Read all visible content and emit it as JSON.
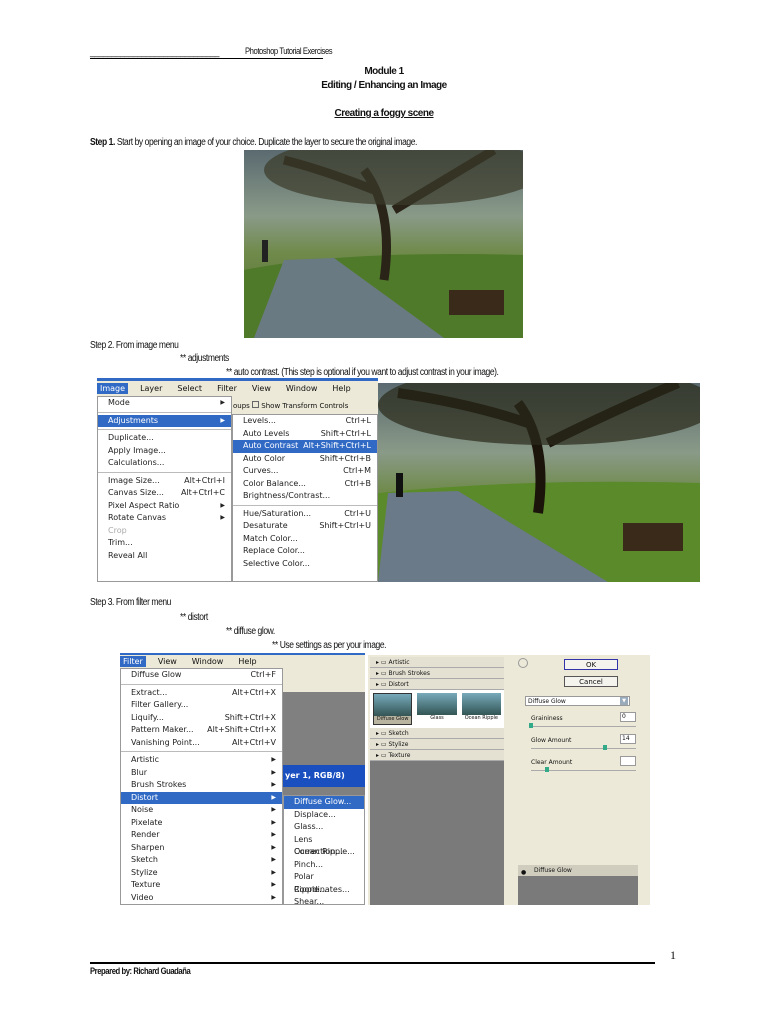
{
  "header": {
    "dashes": "______________________________",
    "title": "Photoshop Tutorial Exercises"
  },
  "module": "Module 1",
  "subtitle": "Editing / Enhancing an Image",
  "section_title": "Creating a foggy scene",
  "step1": {
    "label": "Step 1.",
    "text": "Start by opening an image of your choice. Duplicate the layer to secure the original image."
  },
  "step2": {
    "line1": "Step 2. From image menu",
    "line2": "** adjustments",
    "line3": "** auto contrast. (This step is optional if you want to adjust contrast in your image)."
  },
  "step3": {
    "line1": "Step 3. From filter menu",
    "line2": "** distort",
    "line3": "** diffuse glow.",
    "line4": "** Use settings as per your image."
  },
  "shot2": {
    "menubar": [
      "Image",
      "Layer",
      "Select",
      "Filter",
      "View",
      "Window",
      "Help"
    ],
    "toolbar_text": "oups",
    "toolbar_checkbox": "Show Transform Controls",
    "image_menu": [
      {
        "label": "Mode",
        "arrow": true
      },
      {
        "sep": true
      },
      {
        "label": "Adjustments",
        "arrow": true,
        "sel": true
      },
      {
        "sep": true
      },
      {
        "label": "Duplicate..."
      },
      {
        "label": "Apply Image..."
      },
      {
        "label": "Calculations..."
      },
      {
        "sep": true
      },
      {
        "label": "Image Size...",
        "sc": "Alt+Ctrl+I"
      },
      {
        "label": "Canvas Size...",
        "sc": "Alt+Ctrl+C"
      },
      {
        "label": "Pixel Aspect Ratio",
        "arrow": true
      },
      {
        "label": "Rotate Canvas",
        "arrow": true
      },
      {
        "label": "Crop",
        "dis": true
      },
      {
        "label": "Trim..."
      },
      {
        "label": "Reveal All"
      }
    ],
    "adjust_menu": [
      {
        "label": "Levels...",
        "sc": "Ctrl+L"
      },
      {
        "label": "Auto Levels",
        "sc": "Shift+Ctrl+L"
      },
      {
        "label": "Auto Contrast",
        "sc": "Alt+Shift+Ctrl+L",
        "sel": true
      },
      {
        "label": "Auto Color",
        "sc": "Shift+Ctrl+B"
      },
      {
        "label": "Curves...",
        "sc": "Ctrl+M"
      },
      {
        "label": "Color Balance...",
        "sc": "Ctrl+B"
      },
      {
        "label": "Brightness/Contrast..."
      },
      {
        "sep": true
      },
      {
        "label": "Hue/Saturation...",
        "sc": "Ctrl+U"
      },
      {
        "label": "Desaturate",
        "sc": "Shift+Ctrl+U"
      },
      {
        "label": "Match Color..."
      },
      {
        "label": "Replace Color..."
      },
      {
        "label": "Selective Color..."
      }
    ]
  },
  "shot3": {
    "menubar": [
      "Filter",
      "View",
      "Window",
      "Help"
    ],
    "doc_title": "yer 1, RGB/8)",
    "filter_menu": [
      {
        "label": "Diffuse Glow",
        "sc": "Ctrl+F"
      },
      {
        "sep": true
      },
      {
        "label": "Extract...",
        "sc": "Alt+Ctrl+X"
      },
      {
        "label": "Filter Gallery..."
      },
      {
        "label": "Liquify...",
        "sc": "Shift+Ctrl+X"
      },
      {
        "label": "Pattern Maker...",
        "sc": "Alt+Shift+Ctrl+X"
      },
      {
        "label": "Vanishing Point...",
        "sc": "Alt+Ctrl+V"
      },
      {
        "sep": true
      },
      {
        "label": "Artistic",
        "arrow": true
      },
      {
        "label": "Blur",
        "arrow": true
      },
      {
        "label": "Brush Strokes",
        "arrow": true
      },
      {
        "label": "Distort",
        "arrow": true,
        "sel": true
      },
      {
        "label": "Noise",
        "arrow": true
      },
      {
        "label": "Pixelate",
        "arrow": true
      },
      {
        "label": "Render",
        "arrow": true
      },
      {
        "label": "Sharpen",
        "arrow": true
      },
      {
        "label": "Sketch",
        "arrow": true
      },
      {
        "label": "Stylize",
        "arrow": true
      },
      {
        "label": "Texture",
        "arrow": true
      },
      {
        "label": "Video",
        "arrow": true
      }
    ],
    "distort_menu": [
      {
        "label": "Diffuse Glow...",
        "sel": true
      },
      {
        "label": "Displace..."
      },
      {
        "label": "Glass..."
      },
      {
        "label": "Lens Correction..."
      },
      {
        "label": "Ocean Ripple..."
      },
      {
        "label": "Pinch..."
      },
      {
        "label": "Polar Coordinates..."
      },
      {
        "label": "Ripple..."
      },
      {
        "label": "Shear..."
      }
    ],
    "gallery": {
      "folders_top": [
        "Artistic",
        "Brush Strokes",
        "Distort"
      ],
      "thumbs": [
        "Diffuse Glow",
        "Glass",
        "Ocean Ripple"
      ],
      "folders_bottom": [
        "Sketch",
        "Stylize",
        "Texture"
      ],
      "ok": "OK",
      "cancel": "Cancel",
      "filter_select": "Diffuse Glow",
      "params": [
        {
          "label": "Graininess",
          "value": "0",
          "fraction": 0.0
        },
        {
          "label": "Glow Amount",
          "value": "14",
          "fraction": 0.7
        },
        {
          "label": "Clear Amount",
          "value": "",
          "fraction": 0.15
        }
      ],
      "layer": "Diffuse Glow"
    }
  },
  "footer": {
    "page": "1",
    "prepared": "Prepared by: Richard Guadaña"
  }
}
